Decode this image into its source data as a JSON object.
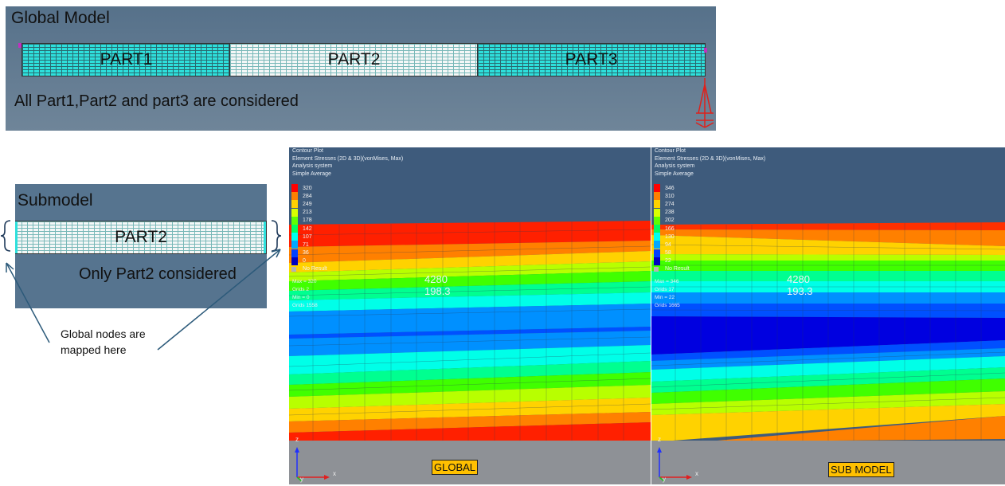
{
  "global_model": {
    "title": "Global Model",
    "parts": [
      "PART1",
      "PART2",
      "PART3"
    ],
    "caption": "All Part1,Part2 and part3 are  considered"
  },
  "submodel": {
    "title": "Submodel",
    "part": "PART2",
    "caption": "Only Part2 considered"
  },
  "annotation": {
    "line1": "Global nodes are",
    "line2": "mapped here"
  },
  "contour_global": {
    "header": [
      "Contour Plot",
      "Element Stresses (2D & 3D)(vonMises, Max)",
      "Analysis system",
      "Simple Average"
    ],
    "legend_values": [
      "320",
      "284",
      "249",
      "213",
      "178",
      "142",
      "107",
      "71",
      "36",
      "0"
    ],
    "no_result": "No Result",
    "stats": [
      "Max = 320",
      "Grids 2",
      "Min = 0",
      "Grids 1558"
    ],
    "pick_id": "4280",
    "pick_value": "198.3",
    "tag": "GLOBAL"
  },
  "contour_sub": {
    "header": [
      "Contour Plot",
      "Element Stresses (2D & 3D)(vonMises, Max)",
      "Analysis system",
      "Simple Average"
    ],
    "legend_values": [
      "346",
      "310",
      "274",
      "238",
      "202",
      "166",
      "130",
      "94",
      "58",
      "22"
    ],
    "no_result": "No Result",
    "stats": [
      "Max = 346",
      "Grids 17",
      "Min = 22",
      "Grids 1665"
    ],
    "pick_id": "4280",
    "pick_value": "193.3",
    "tag": "SUB MODEL"
  },
  "axis_labels": {
    "x": "x",
    "y": "y",
    "z": "z"
  },
  "legend_colors": [
    "#ff0000",
    "#ff8000",
    "#ffd200",
    "#d8ff00",
    "#60ff00",
    "#00ff60",
    "#00fff0",
    "#00a8ff",
    "#0040ff",
    "#0000c0"
  ],
  "colors": {
    "panel_bg": "#3e5b7c",
    "model_bg": "#56748f",
    "mesh_cyan": "#2ee0dc",
    "tag_bg": "#ffc000"
  }
}
